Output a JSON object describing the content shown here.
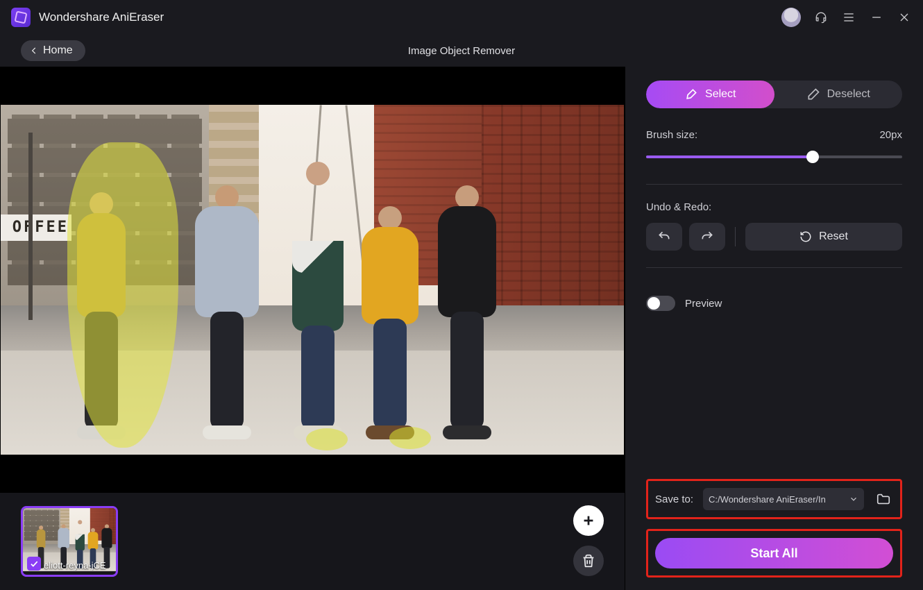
{
  "app": {
    "title": "Wondershare AniEraser"
  },
  "toolbar": {
    "home": "Home",
    "page_title": "Image Object Remover"
  },
  "titlebar_icons": {
    "avatar": "user-avatar",
    "support": "headset-icon",
    "menu": "menu-icon",
    "minimize": "minimize-icon",
    "close": "close-icon"
  },
  "segments": {
    "select": "Select",
    "deselect": "Deselect"
  },
  "brush": {
    "label": "Brush size:",
    "value": "20px",
    "percent": 65
  },
  "undo_redo": {
    "label": "Undo & Redo:",
    "reset": "Reset"
  },
  "preview": {
    "label": "Preview",
    "on": false
  },
  "save": {
    "label": "Save to:",
    "path": "C:/Wondershare AniEraser/In"
  },
  "start": {
    "label": "Start All"
  },
  "thumbnail": {
    "filename": "eliott-reyna-jCE",
    "checked": true
  },
  "strip": {
    "add": "add-image",
    "delete": "delete-image"
  },
  "canvas": {
    "coffee_sign": "OFFEE"
  },
  "colors": {
    "accent_purple": "#8a3df5",
    "accent_pink": "#d24ecb",
    "highlight_red": "#e2231a",
    "mask_yellow": "rgba(225,228,60,.55)"
  }
}
